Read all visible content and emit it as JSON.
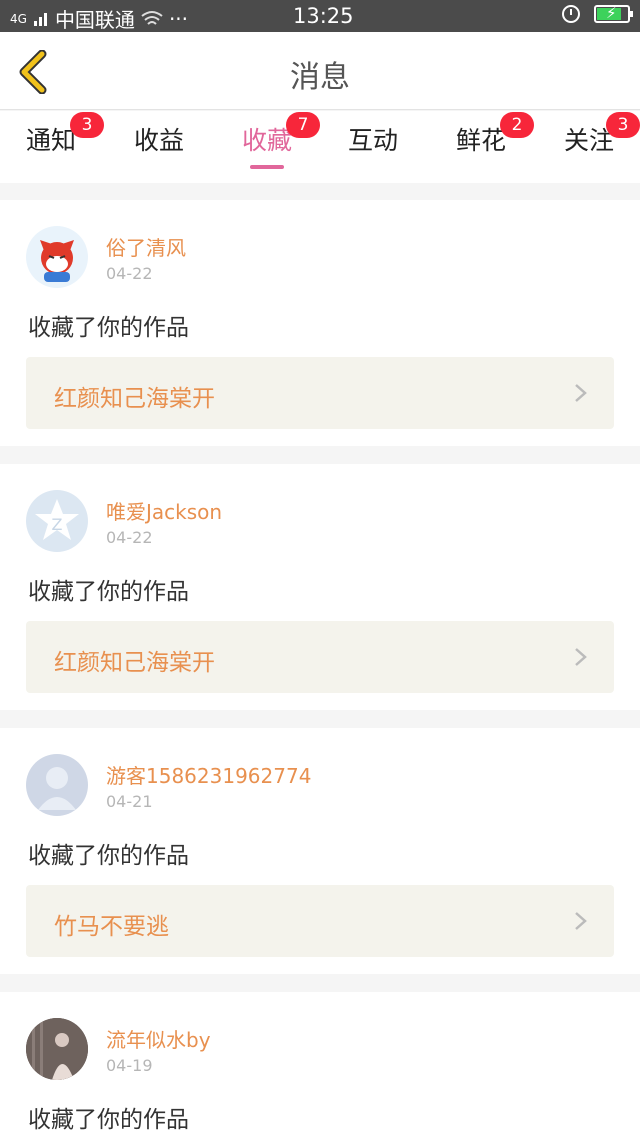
{
  "status_bar": {
    "network": "4G",
    "carrier": "中国联通",
    "more": "···",
    "time": "13:25",
    "battery_level": 0.8
  },
  "header": {
    "title": "消息"
  },
  "tabs": [
    {
      "label": "通知",
      "badge": "3"
    },
    {
      "label": "收益",
      "badge": ""
    },
    {
      "label": "收藏",
      "badge": "7",
      "active": true
    },
    {
      "label": "互动",
      "badge": ""
    },
    {
      "label": "鲜花",
      "badge": "2"
    },
    {
      "label": "关注",
      "badge": "3"
    }
  ],
  "messages": [
    {
      "user": "俗了清风",
      "date": "04-22",
      "action": "收藏了你的作品",
      "work": "红颜知己海棠开",
      "avatar": "cartoon-fox-avatar"
    },
    {
      "user": "唯爱Jackson",
      "date": "04-22",
      "action": "收藏了你的作品",
      "work": "红颜知己海棠开",
      "avatar": "default-star-avatar"
    },
    {
      "user": "游客1586231962774",
      "date": "04-21",
      "action": "收藏了你的作品",
      "work": "竹马不要逃",
      "avatar": "default-person-avatar"
    },
    {
      "user": "流年似水by",
      "date": "04-19",
      "action": "收藏了你的作品",
      "work": "",
      "avatar": "photo-avatar"
    }
  ],
  "colors": {
    "accent": "#e1679b",
    "name": "#e8904f",
    "badge": "#f7263a",
    "back_icon": "#f1c21b"
  }
}
